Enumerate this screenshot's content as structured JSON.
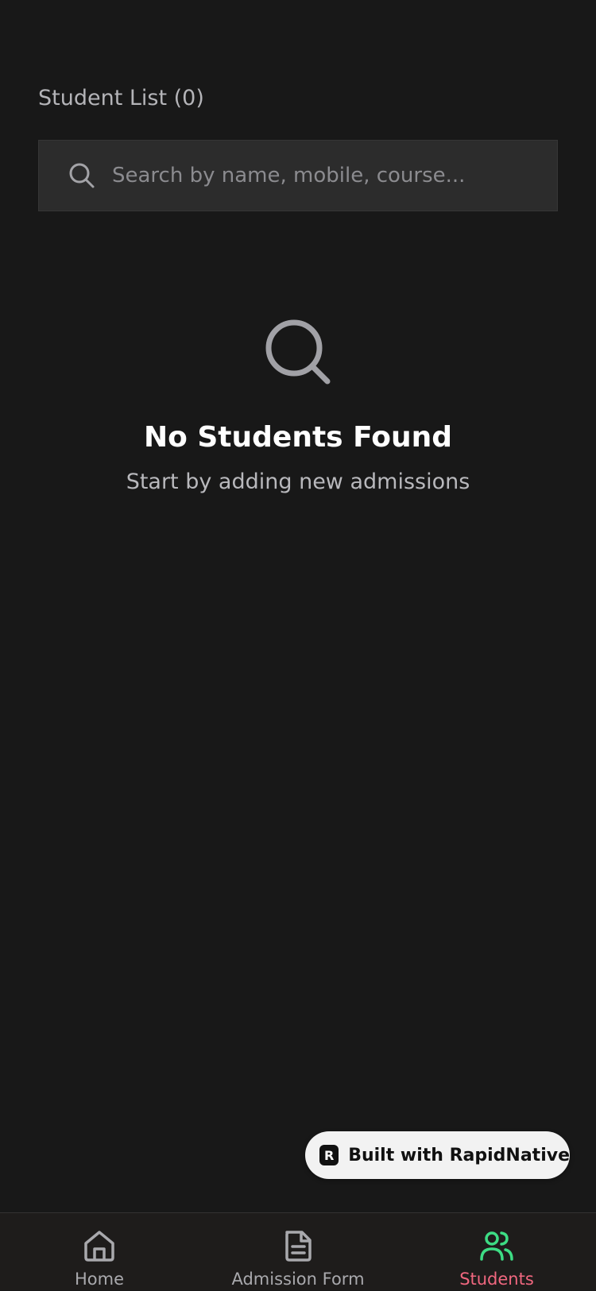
{
  "header": {
    "title": "Student List (0)"
  },
  "search": {
    "placeholder": "Search by name, mobile, course...",
    "value": "",
    "icon": "search-icon"
  },
  "empty_state": {
    "icon": "search-icon",
    "title": "No Students Found",
    "subtitle": "Start by adding new admissions"
  },
  "badge": {
    "logo_letter": "R",
    "label": "Built with RapidNative"
  },
  "tabbar": {
    "tabs": [
      {
        "label": "Home",
        "icon": "home-icon",
        "active": false
      },
      {
        "label": "Admission Form",
        "icon": "document-icon",
        "active": false
      },
      {
        "label": "Students",
        "icon": "users-icon",
        "active": true
      }
    ]
  },
  "colors": {
    "background": "#181818",
    "search_background": "#2c2c2c",
    "active_icon": "#3ddc84",
    "active_label": "#f0677f",
    "inactive": "#a9a9ad"
  }
}
